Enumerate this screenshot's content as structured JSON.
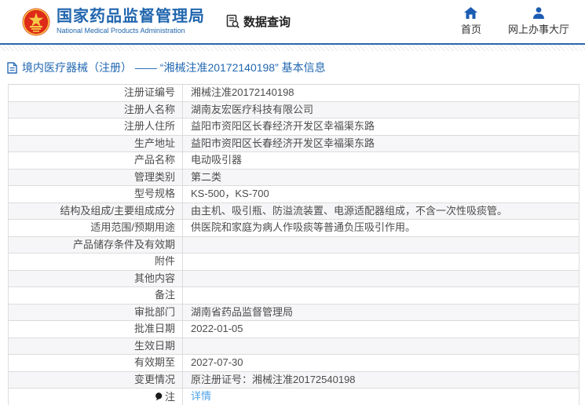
{
  "header": {
    "org_name_cn": "国家药品监督管理局",
    "org_name_en": "National Medical Products Administration",
    "data_query_label": "数据查询",
    "nav": [
      {
        "label": "首页"
      },
      {
        "label": "网上办事大厅"
      }
    ]
  },
  "page": {
    "title": "境内医疗器械（注册） —— “湘械注准20172140198” 基本信息"
  },
  "table": {
    "rows": [
      {
        "label": "注册证编号",
        "value": "湘械注准20172140198"
      },
      {
        "label": "注册人名称",
        "value": "湖南友宏医疗科技有限公司"
      },
      {
        "label": "注册人住所",
        "value": "益阳市资阳区长春经济开发区幸福渠东路"
      },
      {
        "label": "生产地址",
        "value": "益阳市资阳区长春经济开发区幸福渠东路"
      },
      {
        "label": "产品名称",
        "value": "电动吸引器"
      },
      {
        "label": "管理类别",
        "value": "第二类"
      },
      {
        "label": "型号规格",
        "value": "KS-500，KS-700"
      },
      {
        "label": "结构及组成/主要组成成分",
        "value": "由主机、吸引瓶、防溢流装置、电源适配器组成，不含一次性吸痰管。"
      },
      {
        "label": "适用范围/预期用途",
        "value": "供医院和家庭为病人作吸痰等普通负压吸引作用。"
      },
      {
        "label": "产品储存条件及有效期",
        "value": ""
      },
      {
        "label": "附件",
        "value": ""
      },
      {
        "label": "其他内容",
        "value": ""
      },
      {
        "label": "备注",
        "value": ""
      },
      {
        "label": "审批部门",
        "value": "湖南省药品监督管理局"
      },
      {
        "label": "批准日期",
        "value": "2022-01-05"
      },
      {
        "label": "生效日期",
        "value": ""
      },
      {
        "label": "有效期至",
        "value": "2027-07-30"
      },
      {
        "label": "变更情况",
        "value": "原注册证号：湘械注准20172540198"
      },
      {
        "label": "注",
        "value": "详情"
      }
    ]
  },
  "colors": {
    "accent_blue": "#2166ae",
    "link_blue": "#4da3e8",
    "emblem_red": "#de2a18",
    "emblem_gold": "#f7c948"
  }
}
